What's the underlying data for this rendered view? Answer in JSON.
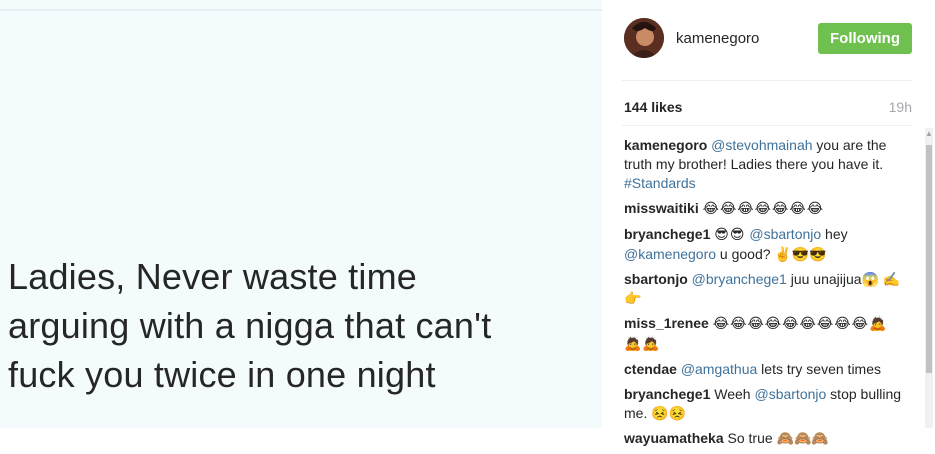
{
  "post": {
    "lines": [
      "Ladies, Never waste time",
      "arguing with a nigga that can't",
      "fuck you twice in one night"
    ]
  },
  "header": {
    "username": "kamenegoro",
    "follow_label": "Following"
  },
  "meta": {
    "likes": "144 likes",
    "time": "19h"
  },
  "comments": [
    {
      "user": "kamenegoro",
      "mention": "@stevohmainah",
      "text": " you are the truth my brother! Ladies there you have it. ",
      "tag": "#Standards"
    },
    {
      "user": "misswaitiki",
      "emoji": "😂😂😂😂😂😂😂"
    },
    {
      "user": "bryanchege1",
      "emoji": "😎😎",
      "mention": "@sbartonjo",
      "text": " hey ",
      "mention2": "@kamenegoro",
      "text2": " u good? ✌😎😎"
    },
    {
      "user": "sbartonjo",
      "mention": "@bryanchege1",
      "text": " juu unajijua😱 ✍👉"
    },
    {
      "user": "miss_1renee",
      "emoji": "😂😂😂😂😂😂😂😂😂🙇🙇🙇"
    },
    {
      "user": "ctendae",
      "mention": "@amgathua",
      "text": " lets try seven times"
    },
    {
      "user": "bryanchege1",
      "text": "Weeh ",
      "mention": "@sbartonjo",
      "text2": " stop bulling me. 😣😣"
    },
    {
      "user": "wayuamatheka",
      "text": "So true 🙈🙈🙈"
    }
  ]
}
